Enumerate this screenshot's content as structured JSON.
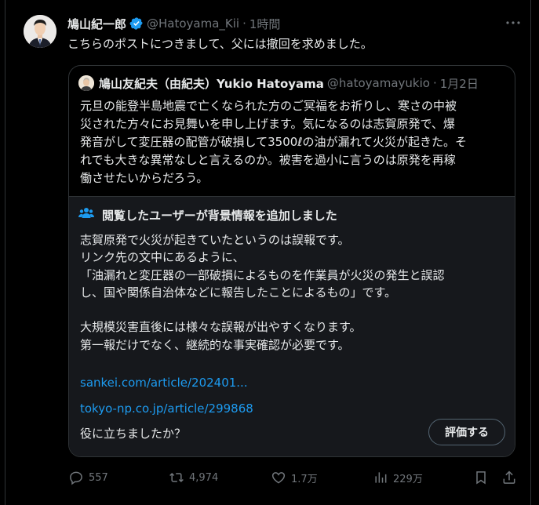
{
  "post": {
    "author_name": "鳩山紀一郎",
    "author_handle": "@Hatoyama_Kii",
    "separator": "·",
    "time": "1時間",
    "text": "こちらのポストにつきまして、父には撤回を求めました。"
  },
  "quoted": {
    "author_name": "鳩山友紀夫（由紀夫）Yukio Hatoyama",
    "author_handle": "@hatoyamayukio",
    "separator": "·",
    "time": "1月2日",
    "lines": [
      "元旦の能登半島地震で亡くなられた方のご冥福をお祈りし、寒さの中被",
      "災された方々にお見舞いを申し上げます。気になるのは志賀原発で、爆",
      "発音がして変圧器の配管が破損して3500ℓの油が漏れて火災が起きた。そ",
      "れでも大きな異常なしと言えるのか。被害を過小に言うのは原発を再稼",
      "働させたいからだろう。"
    ]
  },
  "community_note": {
    "title": "閲覧したユーザーが背景情報を追加しました",
    "lines": [
      "志賀原発で火災が起きていたというのは誤報です。",
      "リンク先の文中にあるように、",
      "「油漏れと変圧器の一部破損によるものを作業員が火災の発生と誤認",
      "し、国や関係自治体などに報告したことによるもの」です。",
      "",
      "大規模災害直後には様々な誤報が出やすくなります。",
      "第一報だけでなく、継続的な事実確認が必要です。"
    ],
    "links": [
      "sankei.com/article/202401...",
      "tokyo-np.co.jp/article/299868"
    ],
    "helpful_question": "役に立ちましたか？",
    "rate_button": "評価する"
  },
  "actions": {
    "replies": "557",
    "reposts": "4,974",
    "likes": "1.7万",
    "views": "229万"
  },
  "colors": {
    "background": "#000000",
    "text": "#e7e9ea",
    "secondary": "#71767b",
    "link": "#1d9bf0",
    "verified": "#1d9bf0",
    "note_bg": "#16181c"
  },
  "icons": [
    "verified-badge-icon",
    "more-icon",
    "community-note-icon",
    "reply-icon",
    "repost-icon",
    "like-icon",
    "views-icon",
    "bookmark-icon",
    "share-icon"
  ]
}
